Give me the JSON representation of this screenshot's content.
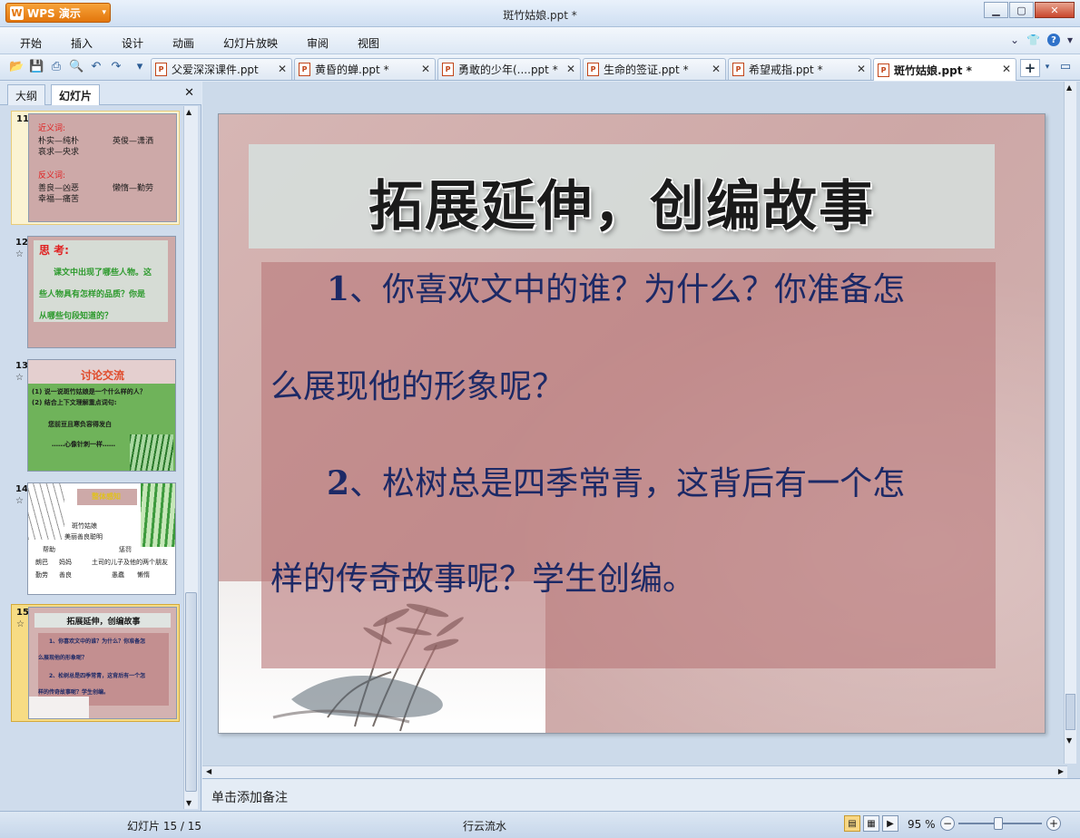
{
  "app": {
    "button_label": "WPS 演示",
    "window_title": "斑竹姑娘.ppt *"
  },
  "menu": [
    "开始",
    "插入",
    "设计",
    "动画",
    "幻灯片放映",
    "审阅",
    "视图"
  ],
  "tabs": [
    {
      "label": "父爱深深课件.ppt"
    },
    {
      "label": "黄昏的蝉.ppt *"
    },
    {
      "label": "勇敢的少年(....ppt *"
    },
    {
      "label": "生命的签证.ppt *"
    },
    {
      "label": "希望戒指.ppt *"
    },
    {
      "label": "斑竹姑娘.ppt *",
      "active": true
    }
  ],
  "left_panel": {
    "tabs": [
      "大纲",
      "幻灯片"
    ],
    "thumbnails": [
      {
        "number": "11",
        "lines": [
          "近义词:",
          "朴实—纯朴",
          "哀求—央求",
          "英俊—潇洒",
          "反义词:",
          "善良—凶恶",
          "幸福—痛苦",
          "懒惰—勤劳"
        ]
      },
      {
        "number": "12",
        "lines": [
          "思  考:",
          "课文中出现了哪些人物。这",
          "些人物具有怎样的品质？你是",
          "从哪些句段知道的？"
        ]
      },
      {
        "number": "13",
        "lines": [
          "讨论交流",
          "(1) 说一说斑竹姑娘是一个什么样的人？",
          "(2) 结合上下文理解重点词句:",
          "您前豆且寒负容得发白",
          "……心像针刺一样……"
        ]
      },
      {
        "number": "14",
        "lines": [
          "整体感知",
          "斑竹姑娘",
          "美丽善良聪明",
          "帮助",
          "惩罚",
          "朗巴",
          "妈妈",
          "土司的儿子及他的两个朋友",
          "勤劳",
          "善良",
          "愚蠢",
          "懒惰"
        ]
      },
      {
        "number": "15",
        "lines": [
          "拓展延伸，创编故事",
          "1、你喜欢文中的谁？为什么？你准备怎",
          "么展现他的形象呢？",
          "2、松树总是四季常青，这背后有一个怎",
          "样的传奇故事呢？学生创编。"
        ]
      }
    ]
  },
  "slide": {
    "title": "拓展延伸，创编故事",
    "para1_num": "1",
    "para1_line1": "、你喜欢文中的谁？为什么？你准备怎",
    "para1_line2": "么展现他的形象呢？",
    "para2_num": "2",
    "para2_line1": "、松树总是四季常青，这背后有一个怎",
    "para2_line2": "样的传奇故事呢？学生创编。"
  },
  "notes_placeholder": "单击添加备注",
  "status": {
    "slide_counter": "幻灯片 15 / 15",
    "theme": "行云流水",
    "zoom": "95 %"
  },
  "colors": {
    "accent": "#e3760c",
    "slide_text": "#1c2966",
    "selection": "#f5d36b"
  }
}
